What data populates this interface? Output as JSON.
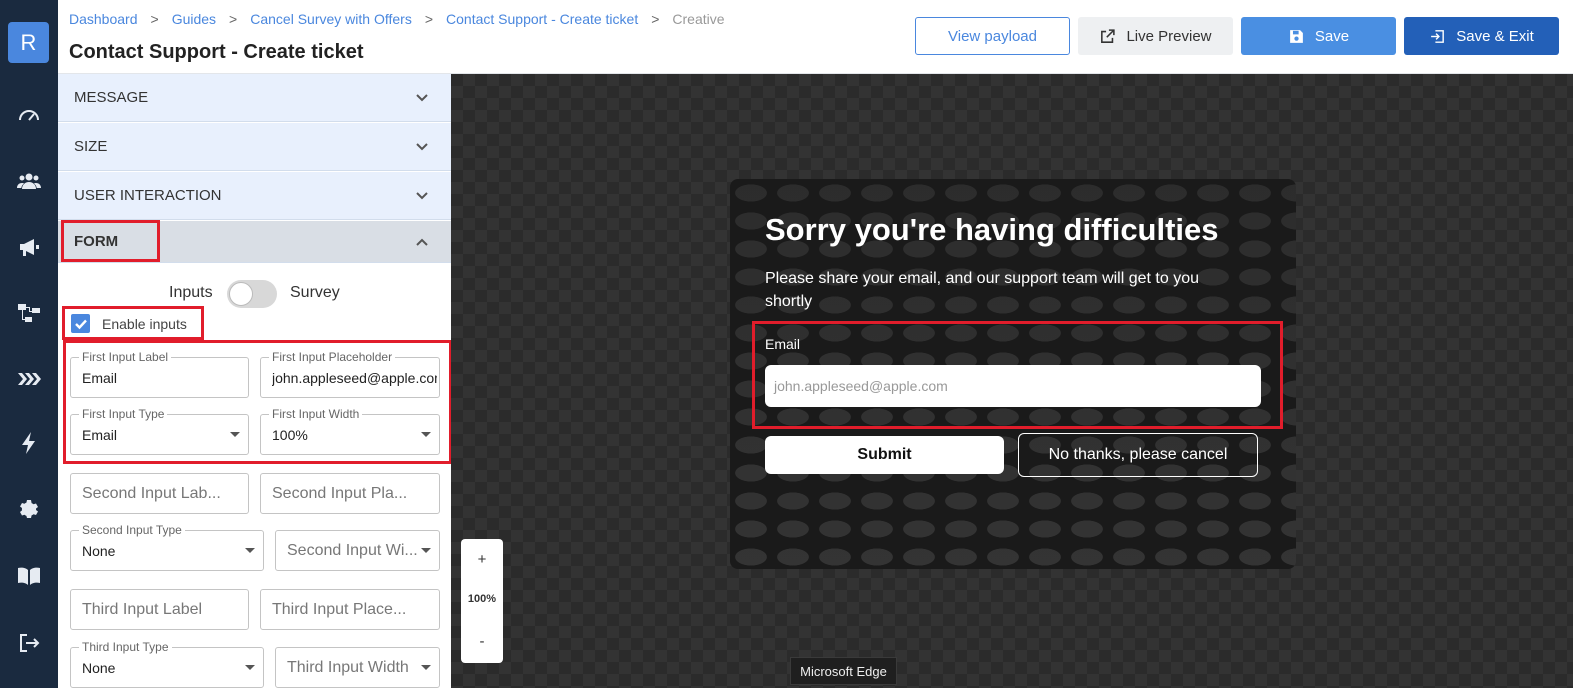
{
  "sidebar": {
    "logo": "R",
    "icons": [
      "dashboard-icon",
      "users-icon",
      "megaphone-icon",
      "flow-icon",
      "guides-icon",
      "bolt-icon",
      "gear-icon",
      "book-icon",
      "logout-icon"
    ]
  },
  "header": {
    "breadcrumbs": [
      "Dashboard",
      "Guides",
      "Cancel Survey with Offers",
      "Contact Support - Create ticket",
      "Creative"
    ],
    "title": "Contact Support - Create ticket",
    "buttons": {
      "view_payload": "View payload",
      "live_preview": "Live Preview",
      "save": "Save",
      "save_exit": "Save & Exit"
    }
  },
  "panel": {
    "sections": [
      "MESSAGE",
      "SIZE",
      "USER INTERACTION",
      "FORM"
    ],
    "toggle": {
      "left": "Inputs",
      "right": "Survey",
      "on": false
    },
    "enable_inputs": {
      "label": "Enable inputs",
      "checked": true
    },
    "fields": {
      "first_label": {
        "label": "First Input Label",
        "value": "Email"
      },
      "first_placeholder": {
        "label": "First Input Placeholder",
        "value": "john.appleseed@apple.com"
      },
      "first_type": {
        "label": "First Input Type",
        "value": "Email"
      },
      "first_width": {
        "label": "First Input Width",
        "value": "100%"
      },
      "second_label": {
        "placeholder": "Second Input Lab..."
      },
      "second_placeholder": {
        "placeholder": "Second Input Pla..."
      },
      "second_type": {
        "label": "Second Input Type",
        "value": "None"
      },
      "second_width": {
        "placeholder": "Second Input Wi..."
      },
      "third_label": {
        "placeholder": "Third Input Label"
      },
      "third_placeholder": {
        "placeholder": "Third Input Place..."
      },
      "third_type": {
        "label": "Third Input Type",
        "value": "None"
      },
      "third_width": {
        "placeholder": "Third Input Width"
      }
    }
  },
  "preview": {
    "title": "Sorry you're having difficulties",
    "subtitle": "Please share your email, and our support team will get to you shortly",
    "email_label": "Email",
    "email_placeholder": "john.appleseed@apple.com",
    "submit": "Submit",
    "cancel": "No thanks, please cancel"
  },
  "zoom": {
    "plus": "+",
    "level": "100%",
    "minus": "-"
  },
  "tooltip": "Microsoft Edge",
  "colors": {
    "accent": "#4a87de",
    "highlight": "#e11d2b",
    "sidebar": "#1a2a3f"
  }
}
